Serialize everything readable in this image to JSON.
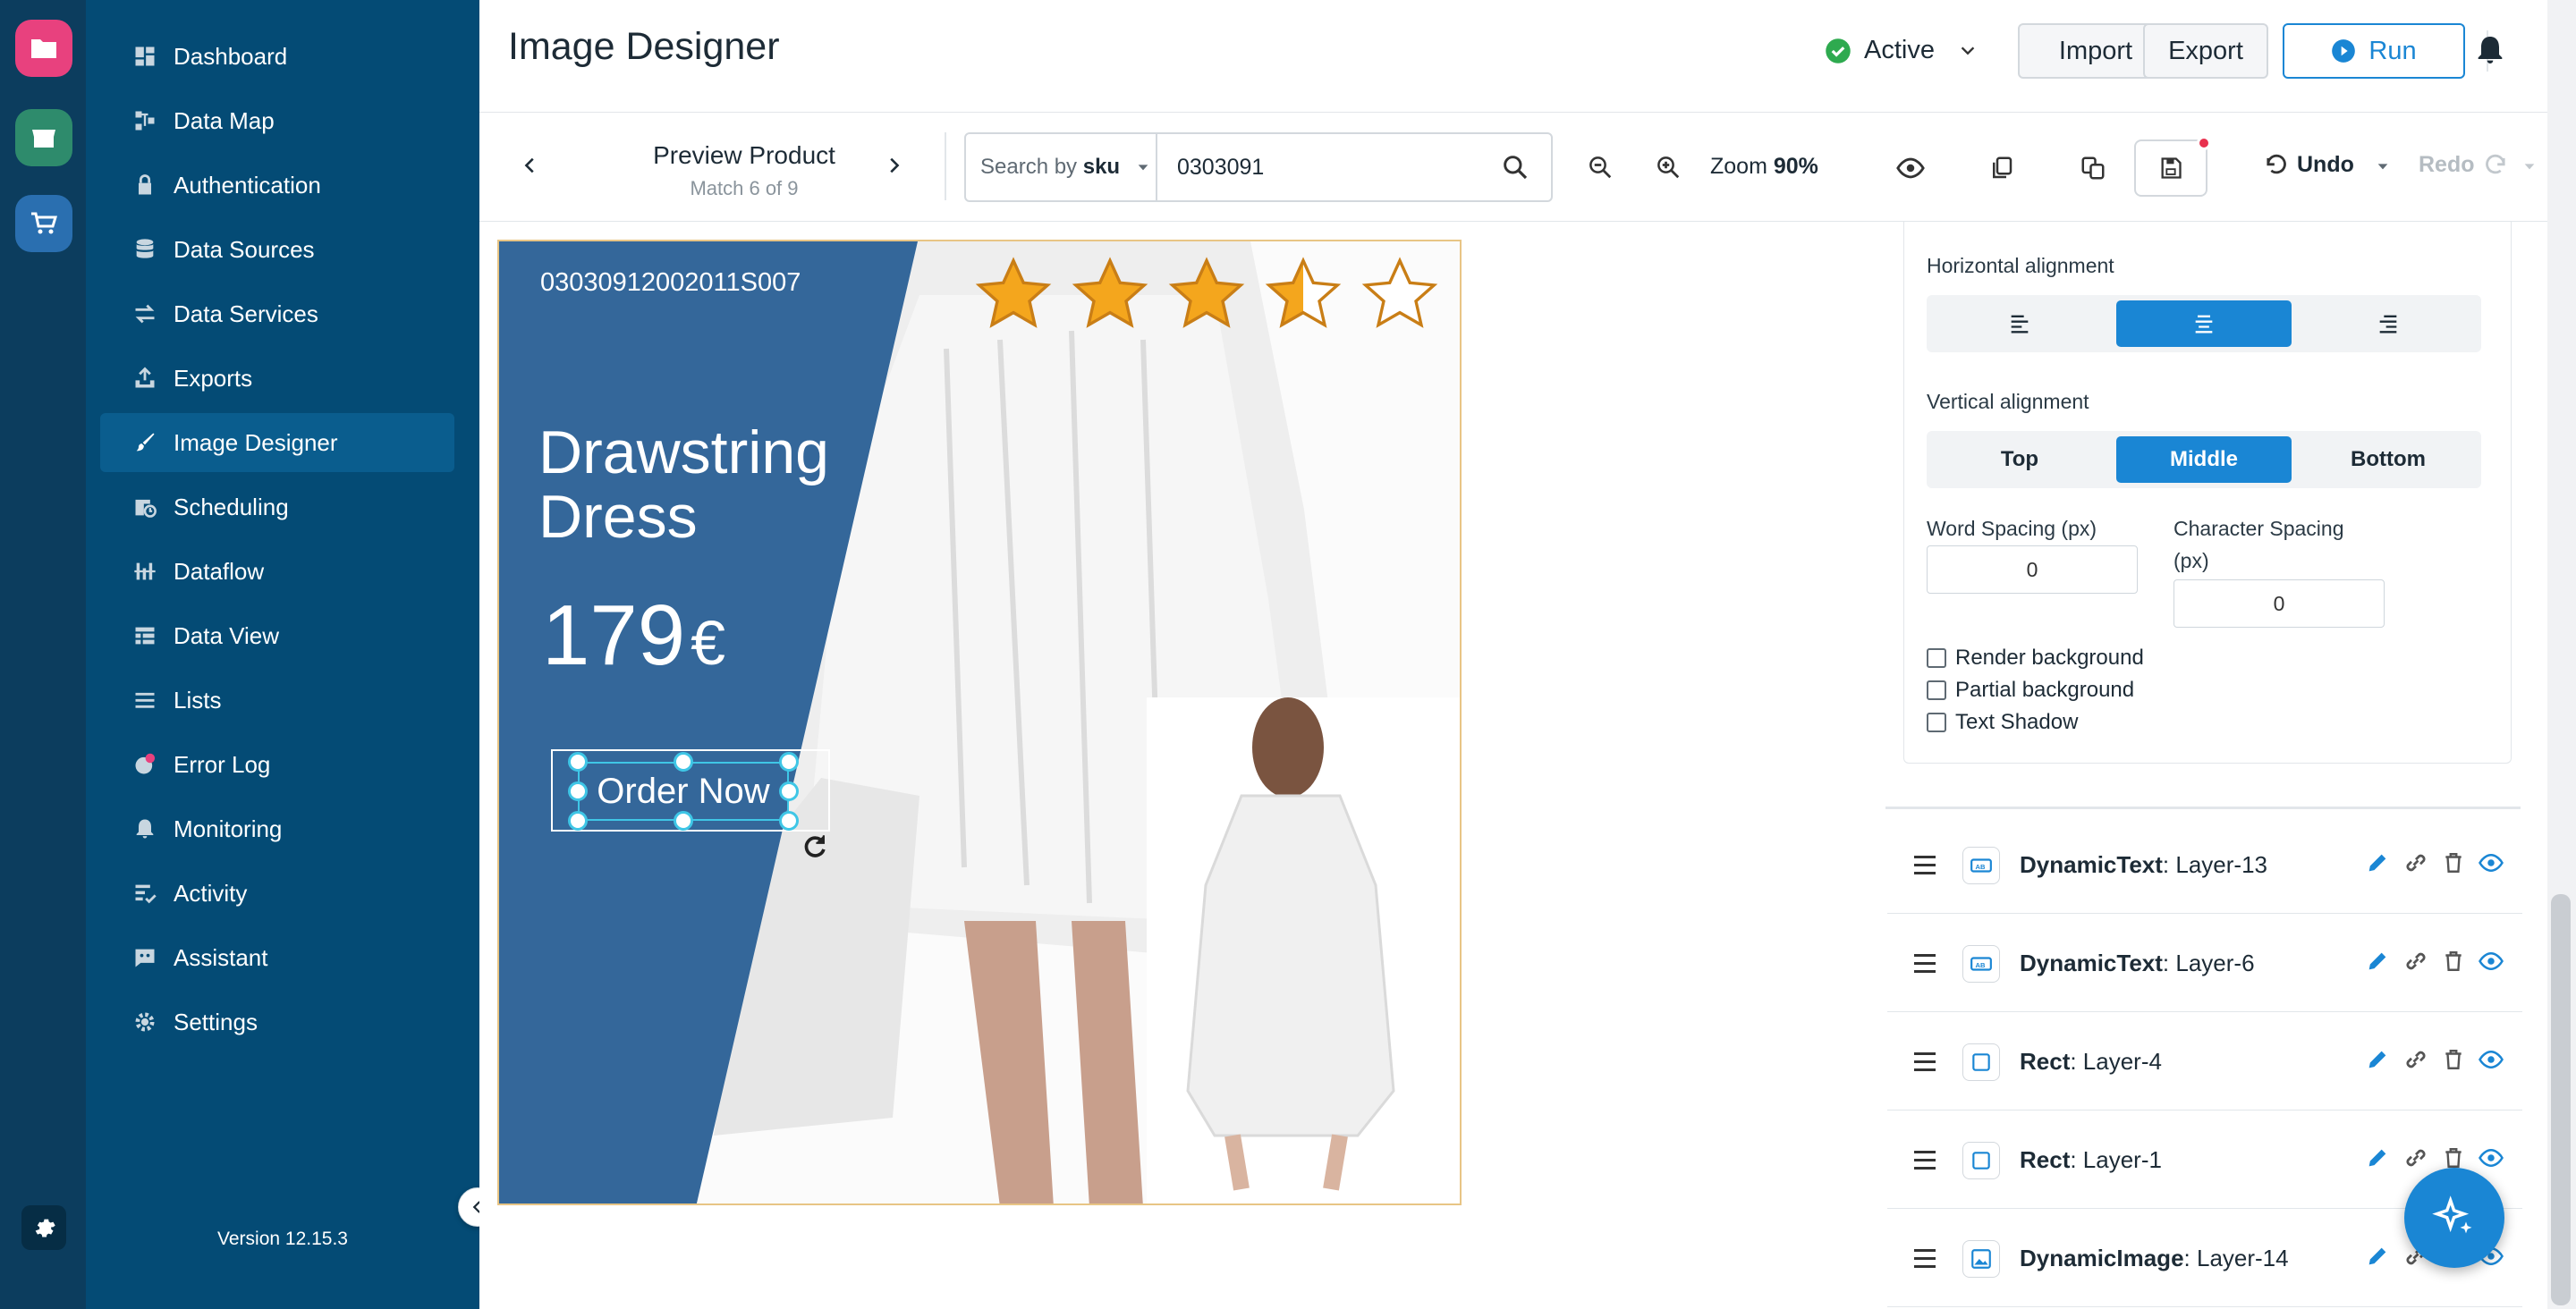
{
  "app": {
    "rail_settings_icon": "gear-icon"
  },
  "sidebar": {
    "items": [
      {
        "label": "Dashboard",
        "icon": "dashboard-icon"
      },
      {
        "label": "Data Map",
        "icon": "data-map-icon"
      },
      {
        "label": "Authentication",
        "icon": "lock-icon"
      },
      {
        "label": "Data Sources",
        "icon": "database-icon"
      },
      {
        "label": "Data Services",
        "icon": "transfer-icon"
      },
      {
        "label": "Exports",
        "icon": "export-icon"
      },
      {
        "label": "Image Designer",
        "icon": "brush-icon"
      },
      {
        "label": "Scheduling",
        "icon": "calendar-clock-icon"
      },
      {
        "label": "Dataflow",
        "icon": "dataflow-icon"
      },
      {
        "label": "Data View",
        "icon": "table-icon"
      },
      {
        "label": "Lists",
        "icon": "list-icon"
      },
      {
        "label": "Error Log",
        "icon": "error-icon"
      },
      {
        "label": "Monitoring",
        "icon": "bell-icon"
      },
      {
        "label": "Activity",
        "icon": "activity-icon"
      },
      {
        "label": "Assistant",
        "icon": "chat-icon"
      },
      {
        "label": "Settings",
        "icon": "gear-icon"
      }
    ],
    "active": "Image Designer",
    "version": "Version 12.15.3"
  },
  "header": {
    "title": "Image Designer",
    "status": "Active",
    "status_color": "#2eaa4f",
    "import_label": "Import",
    "export_label": "Export",
    "run_label": "Run"
  },
  "toolbar": {
    "preview_title": "Preview Product",
    "preview_sub": "Match 6 of 9",
    "search_by_prefix": "Search by ",
    "search_by_field": "sku",
    "search_value": "0303091",
    "zoom_prefix": "Zoom ",
    "zoom_value": "90%",
    "undo_label": "Undo",
    "redo_label": "Redo"
  },
  "canvas": {
    "sku": "03030912002011S007",
    "title_line1": "Drawstring",
    "title_line2": "Dress",
    "price": "179",
    "currency": "€",
    "cta": "Order Now",
    "rating": 3.5,
    "rating_max": 5,
    "brand_color": "#34679a",
    "star_color": "#f4a61d"
  },
  "panel": {
    "h_align_label": "Horizontal alignment",
    "h_align_selected": "center",
    "v_align_label": "Vertical alignment",
    "v_align_options": [
      "Top",
      "Middle",
      "Bottom"
    ],
    "v_align_selected": "Middle",
    "word_spacing_label": "Word Spacing (px)",
    "word_spacing_value": "0",
    "char_spacing_label_1": "Character Spacing",
    "char_spacing_label_2": "(px)",
    "char_spacing_value": "0",
    "checkboxes": [
      {
        "label": "Render background",
        "checked": false
      },
      {
        "label": "Partial background",
        "checked": false
      },
      {
        "label": "Text Shadow",
        "checked": false
      }
    ],
    "accent_color": "#1a86d4"
  },
  "layers": [
    {
      "type": "DynamicText",
      "name": ": Layer-13",
      "icon": "text-field-icon"
    },
    {
      "type": "DynamicText",
      "name": ": Layer-6",
      "icon": "text-field-icon"
    },
    {
      "type": "Rect",
      "name": ": Layer-4",
      "icon": "rect-icon"
    },
    {
      "type": "Rect",
      "name": ": Layer-1",
      "icon": "rect-icon"
    },
    {
      "type": "DynamicImage",
      "name": ": Layer-14",
      "icon": "image-icon"
    }
  ]
}
